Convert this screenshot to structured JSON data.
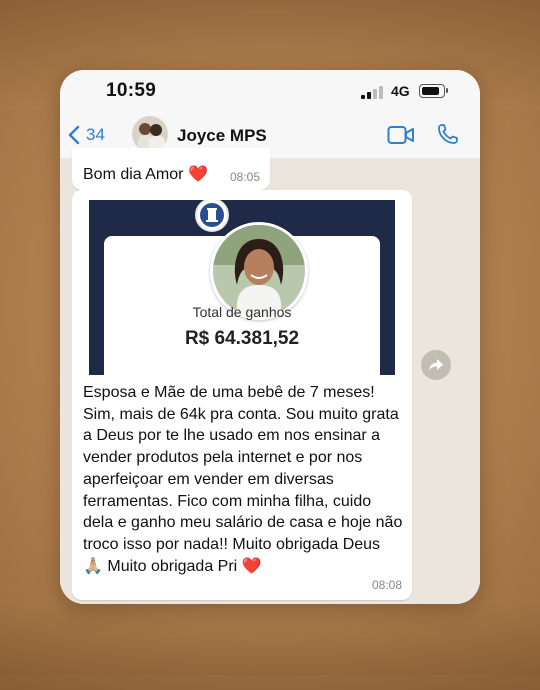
{
  "status_bar": {
    "time": "10:59",
    "network": "4G",
    "battery_level": 0.85
  },
  "header": {
    "back_count": "34",
    "contact_name": "Joyce MPS"
  },
  "messages": [
    {
      "text": "Bom dia Amor",
      "emoji": "❤️",
      "time": "08:05"
    },
    {
      "card": {
        "label": "Total de ganhos",
        "value": "R$ 64.381,52"
      },
      "text": "Esposa e Mãe de uma bebê de 7 meses! Sim, mais de 64k pra conta. Sou muito grata a Deus por te lhe usado em nos ensinar a vender produtos pela internet e por nos aperfeiçoar em vender em diversas ferramentas. Fico com minha filha, cuido dela e ganho meu salário de casa e hoje não troco isso por nada!! Muito obrigada Deus 🙏🏼 Muito obrigada Pri ❤️",
      "time": "08:08"
    }
  ],
  "icons": [
    "chevron-left-icon",
    "video-call-icon",
    "phone-call-icon",
    "forward-icon",
    "logo-icon"
  ],
  "colors": {
    "accent": "#2f7fd0",
    "card_bg": "#1e2a47",
    "chat_bg": "#ece5dd",
    "heart": "#e0232e"
  }
}
